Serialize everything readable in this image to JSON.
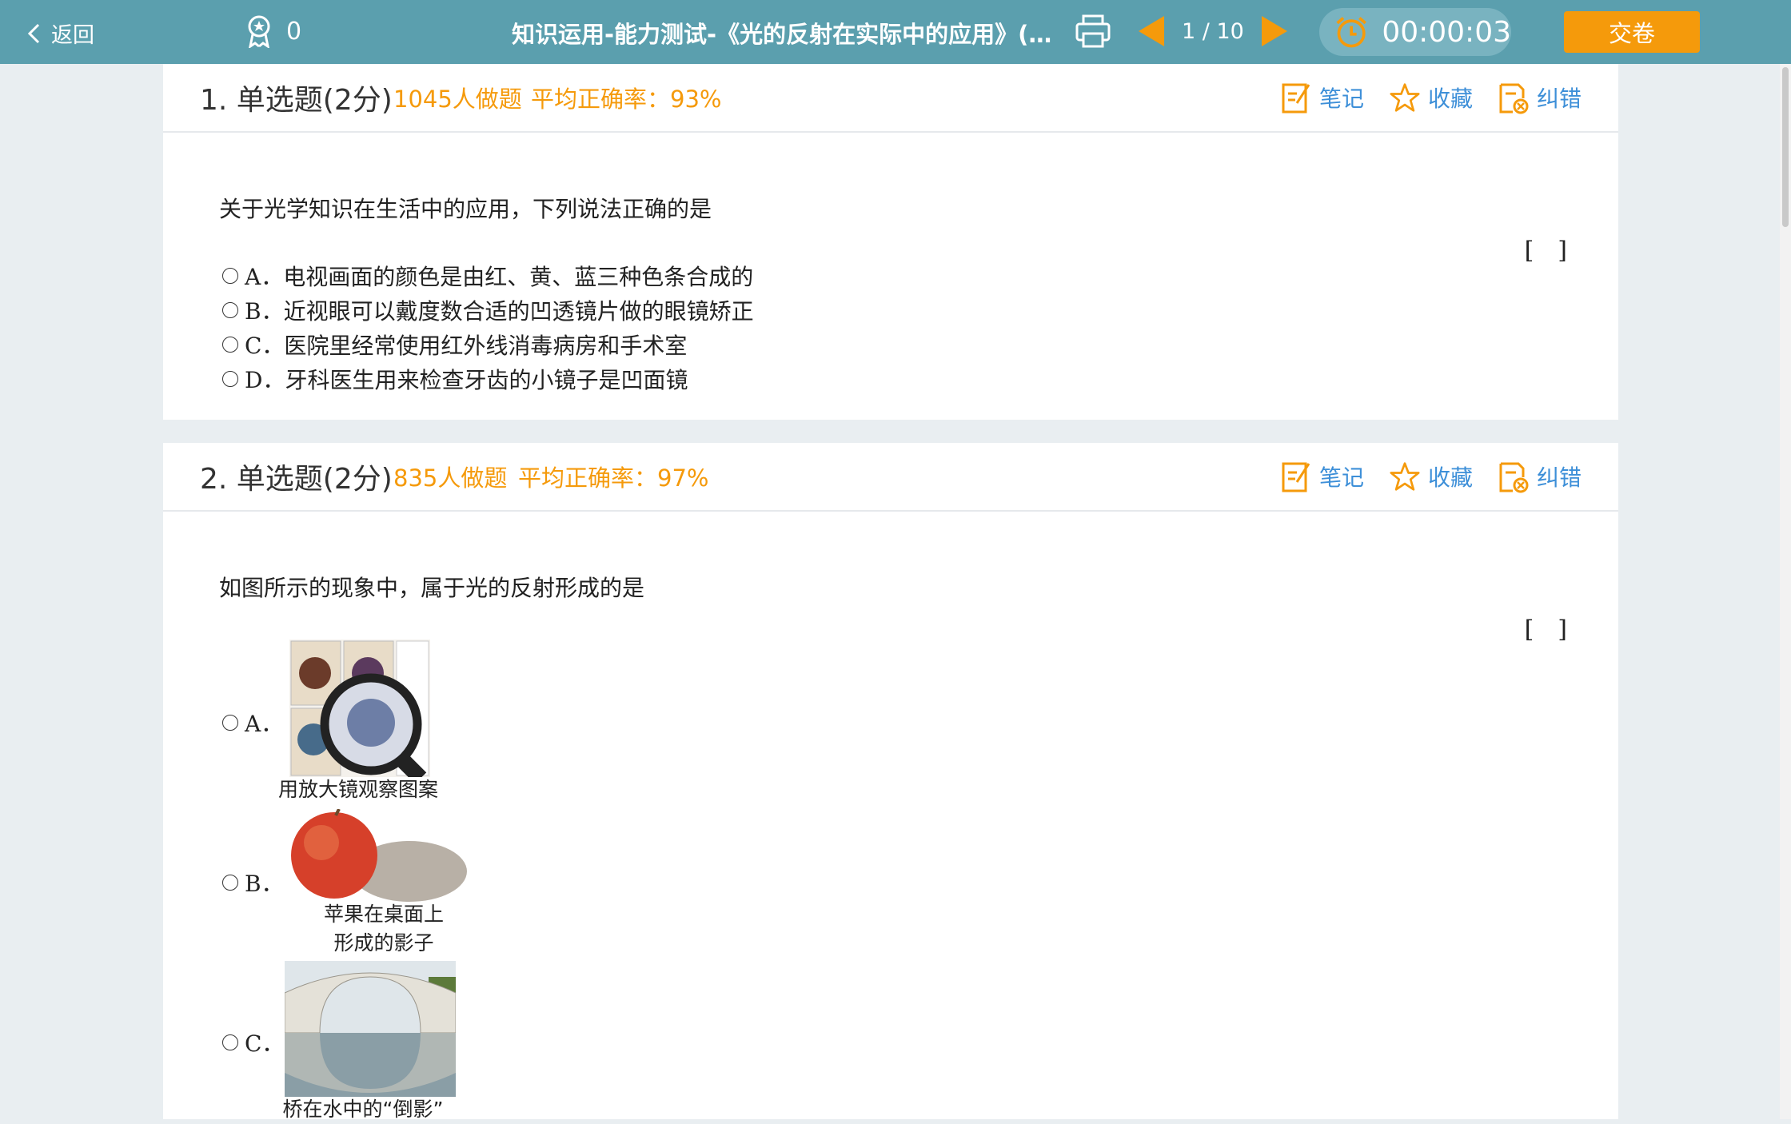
{
  "topbar": {
    "back_label": "返回",
    "points": "0",
    "title": "知识运用-能力测试-《光的反射在实际中的应用》(…",
    "page_indicator": "1 / 10",
    "timer": "00:00:03",
    "submit_label": "交卷"
  },
  "tools": {
    "note": "笔记",
    "favorite": "收藏",
    "report": "纠错"
  },
  "questions": [
    {
      "number": "1. 单选题(2分)",
      "attempts": "1045人做题",
      "accuracy": "平均正确率：93%",
      "stem": "关于光学知识在生活中的应用，下列说法正确的是",
      "bracket": "[　]",
      "options": [
        {
          "label": "A．电视画面的颜色是由红、黄、蓝三种色条合成的"
        },
        {
          "label": "B．近视眼可以戴度数合适的凹透镜片做的眼镜矫正"
        },
        {
          "label": "C．医院里经常使用红外线消毒病房和手术室"
        },
        {
          "label": "D．牙科医生用来检查牙齿的小镜子是凹面镜"
        }
      ]
    },
    {
      "number": "2. 单选题(2分)",
      "attempts": "835人做题",
      "accuracy": "平均正确率：97%",
      "stem": "如图所示的现象中，属于光的反射形成的是",
      "bracket": "[　]",
      "options": [
        {
          "label": "A．",
          "caption": "用放大镜观察图案"
        },
        {
          "label": "B．",
          "caption_line1": "苹果在桌面上",
          "caption_line2": "形成的影子"
        },
        {
          "label": "C．",
          "caption": "桥在水中的“倒影”"
        }
      ]
    }
  ],
  "colors": {
    "topbar": "#5b9fae",
    "accent": "#f59a0b",
    "link": "#3d8fd8"
  }
}
